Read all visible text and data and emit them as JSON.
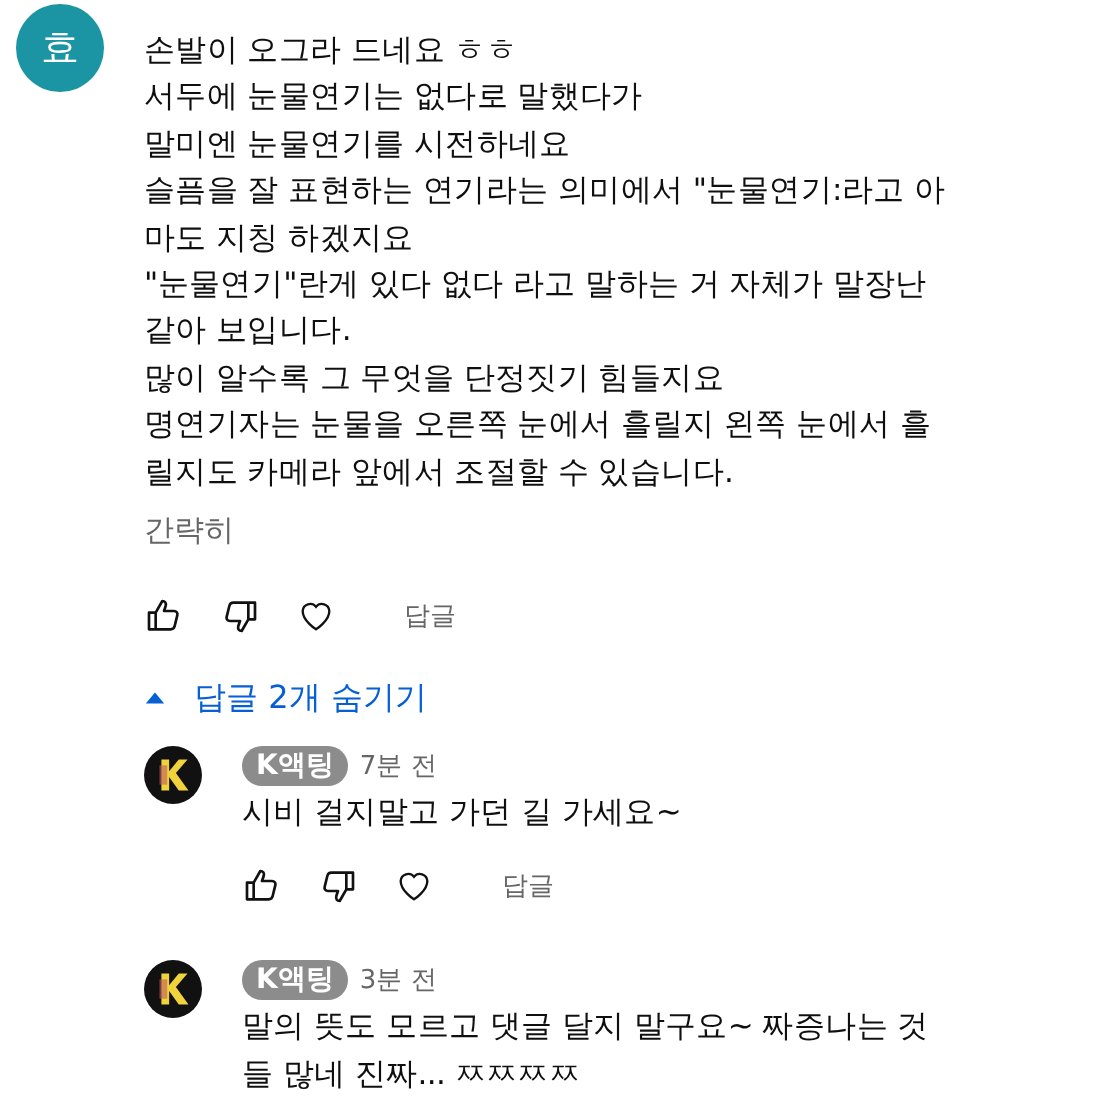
{
  "comment": {
    "avatar": "효",
    "lines": [
      "손발이 오그라 드네요 ㅎㅎ",
      "서두에 눈물연기는 없다로 말했다가",
      "말미엔 눈물연기를 시전하네요",
      "슬픔을 잘 표현하는 연기라는 의미에서 \"눈물연기:라고 아",
      "마도 지칭 하겠지요",
      "\"눈물연기\"란게 있다 없다 라고 말하는 거 자체가 말장난",
      "같아 보입니다.",
      "많이 알수록 그 무엇을 단정짓기 힘들지요",
      "명연기자는 눈물을 오른쪽 눈에서 흘릴지 왼쪽 눈에서 흘",
      "릴지도 카메라 앞에서 조절할 수 있습니다."
    ],
    "collapse": "간략히",
    "reply_button": "답글"
  },
  "replies_toggle": {
    "label": "답글 2개 숨기기",
    "expanded": true
  },
  "replies": [
    {
      "author": "K액팅",
      "time": "7분 전",
      "lines": [
        "시비 걸지말고 가던 길 가세요~"
      ],
      "reply_button": "답글"
    },
    {
      "author": "K액팅",
      "time": "3분 전",
      "lines": [
        "말의 뜻도 모르고 댓글 달지 말구요~ 짜증나는 것",
        "들 많네 진짜... ㅉㅉㅉㅉ"
      ]
    }
  ]
}
